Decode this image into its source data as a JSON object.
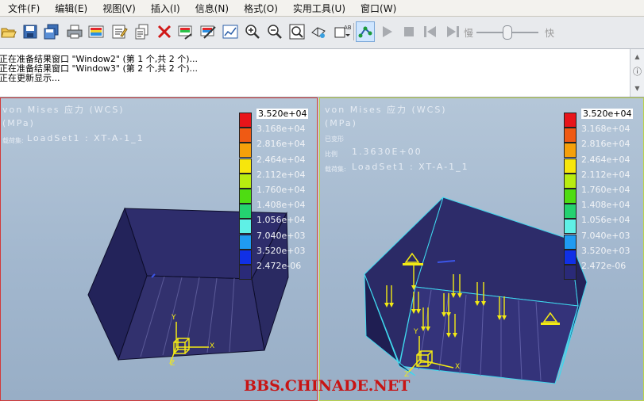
{
  "menu": [
    "文件(F)",
    "编辑(E)",
    "视图(V)",
    "插入(I)",
    "信息(N)",
    "格式(O)",
    "实用工具(U)",
    "窗口(W)"
  ],
  "toolbar": {
    "slow_label": "慢",
    "fast_label": "快",
    "animation_speed": 0.5
  },
  "messages": [
    "正在准备结果窗口 \"Window2\" (第 1 个,共 2 个)...",
    "正在准备结果窗口 \"Window3\" (第 2 个,共 2 个)...",
    "正在更新显示..."
  ],
  "left_view": {
    "title": "von Mises 应力 (WCS)",
    "unit": "(MPa)",
    "load_label": "载荷集:",
    "load_value": "LoadSet1 : XT-A-1_1"
  },
  "right_view": {
    "title": "von Mises 应力 (WCS)",
    "unit": "(MPa)",
    "deformed": "已变形",
    "scale_label": "比例",
    "scale_value": "1.3630E+00",
    "load_label": "载荷集:",
    "load_value": "LoadSet1 : XT-A-1_1"
  },
  "legend": {
    "labels": [
      "3.520e+04",
      "3.168e+04",
      "2.816e+04",
      "2.464e+04",
      "2.112e+04",
      "1.760e+04",
      "1.408e+04",
      "1.056e+04",
      "7.040e+03",
      "3.520e+03",
      "2.472e-06"
    ],
    "colors": [
      "#e8141a",
      "#ef5a14",
      "#f5a00a",
      "#f7e60c",
      "#b8ec10",
      "#4edc12",
      "#24d270",
      "#5ff0e6",
      "#1f9bf2",
      "#1030e6",
      "#2a2a78"
    ]
  },
  "axes": {
    "x": "X",
    "y": "Y",
    "z": "Z"
  },
  "watermark": "BBS.CHINADE.NET"
}
